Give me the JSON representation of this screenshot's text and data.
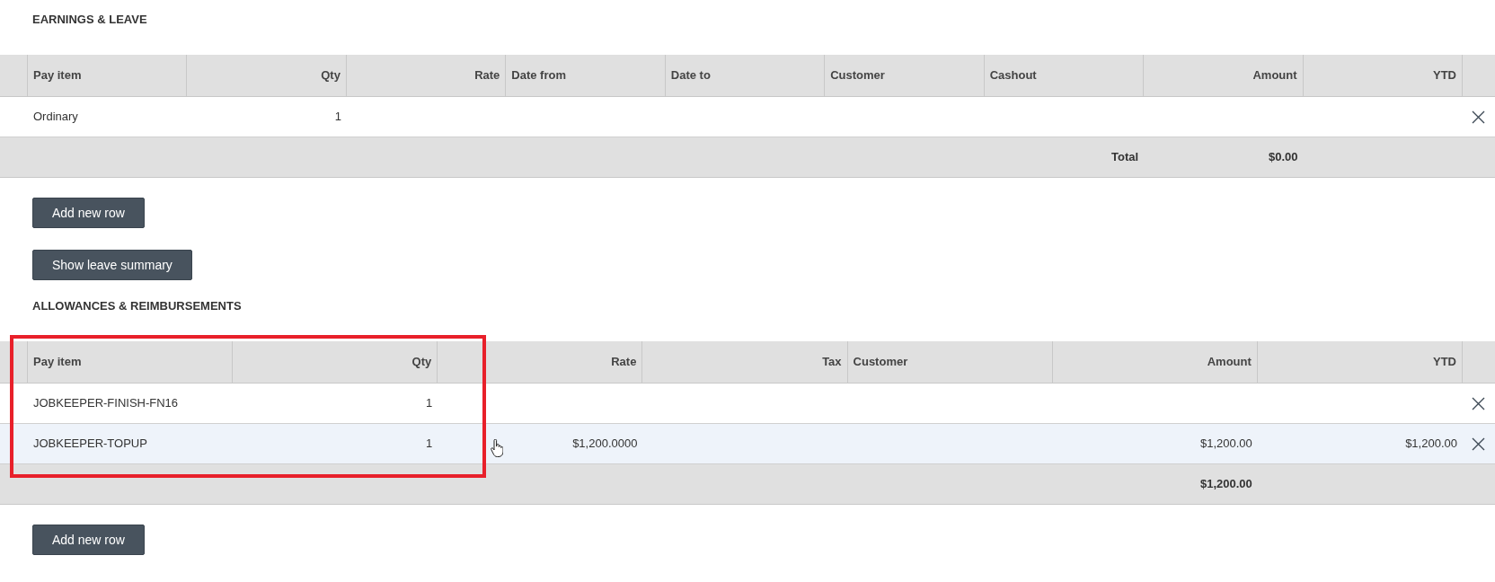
{
  "sections": [
    {
      "title": "EARNINGS & LEAVE",
      "columns": {
        "pay_item": {
          "label": "Pay item",
          "kind": "text"
        },
        "qty": {
          "label": "Qty",
          "kind": "number"
        },
        "rate": {
          "label": "Rate",
          "kind": "number"
        },
        "date_from": {
          "label": "Date from",
          "kind": "text"
        },
        "date_to": {
          "label": "Date to",
          "kind": "text"
        },
        "customer": {
          "label": "Customer",
          "kind": "text"
        },
        "cashout": {
          "label": "Cashout",
          "kind": "text"
        },
        "amount": {
          "label": "Amount",
          "kind": "number"
        },
        "ytd": {
          "label": "YTD",
          "kind": "number"
        }
      },
      "rows": [
        {
          "hovered": false,
          "cells": {
            "pay_item": "Ordinary",
            "qty": "1"
          }
        }
      ],
      "total": {
        "cashout": "Total",
        "amount": "$0.00"
      },
      "buttons": [
        "Add new row",
        "Show leave summary"
      ]
    },
    {
      "title": "ALLOWANCES & REIMBURSEMENTS",
      "columns": {
        "pay_item": {
          "label": "Pay item",
          "kind": "text"
        },
        "qty": {
          "label": "Qty",
          "kind": "number"
        },
        "rate": {
          "label": "Rate",
          "kind": "number"
        },
        "tax": {
          "label": "Tax",
          "kind": "number"
        },
        "customer": {
          "label": "Customer",
          "kind": "text"
        },
        "amount": {
          "label": "Amount",
          "kind": "number"
        },
        "ytd": {
          "label": "YTD",
          "kind": "number"
        }
      },
      "rows": [
        {
          "hovered": false,
          "cells": {
            "pay_item": "JOBKEEPER-FINISH-FN16",
            "qty": "1"
          }
        },
        {
          "hovered": true,
          "cells": {
            "pay_item": "JOBKEEPER-TOPUP",
            "qty": "1",
            "rate": "$1,200.0000",
            "amount": "$1,200.00",
            "ytd": "$1,200.00"
          }
        }
      ],
      "total": {
        "amount": "$1,200.00"
      },
      "buttons": [
        "Add new row"
      ],
      "highlighted": true
    }
  ]
}
